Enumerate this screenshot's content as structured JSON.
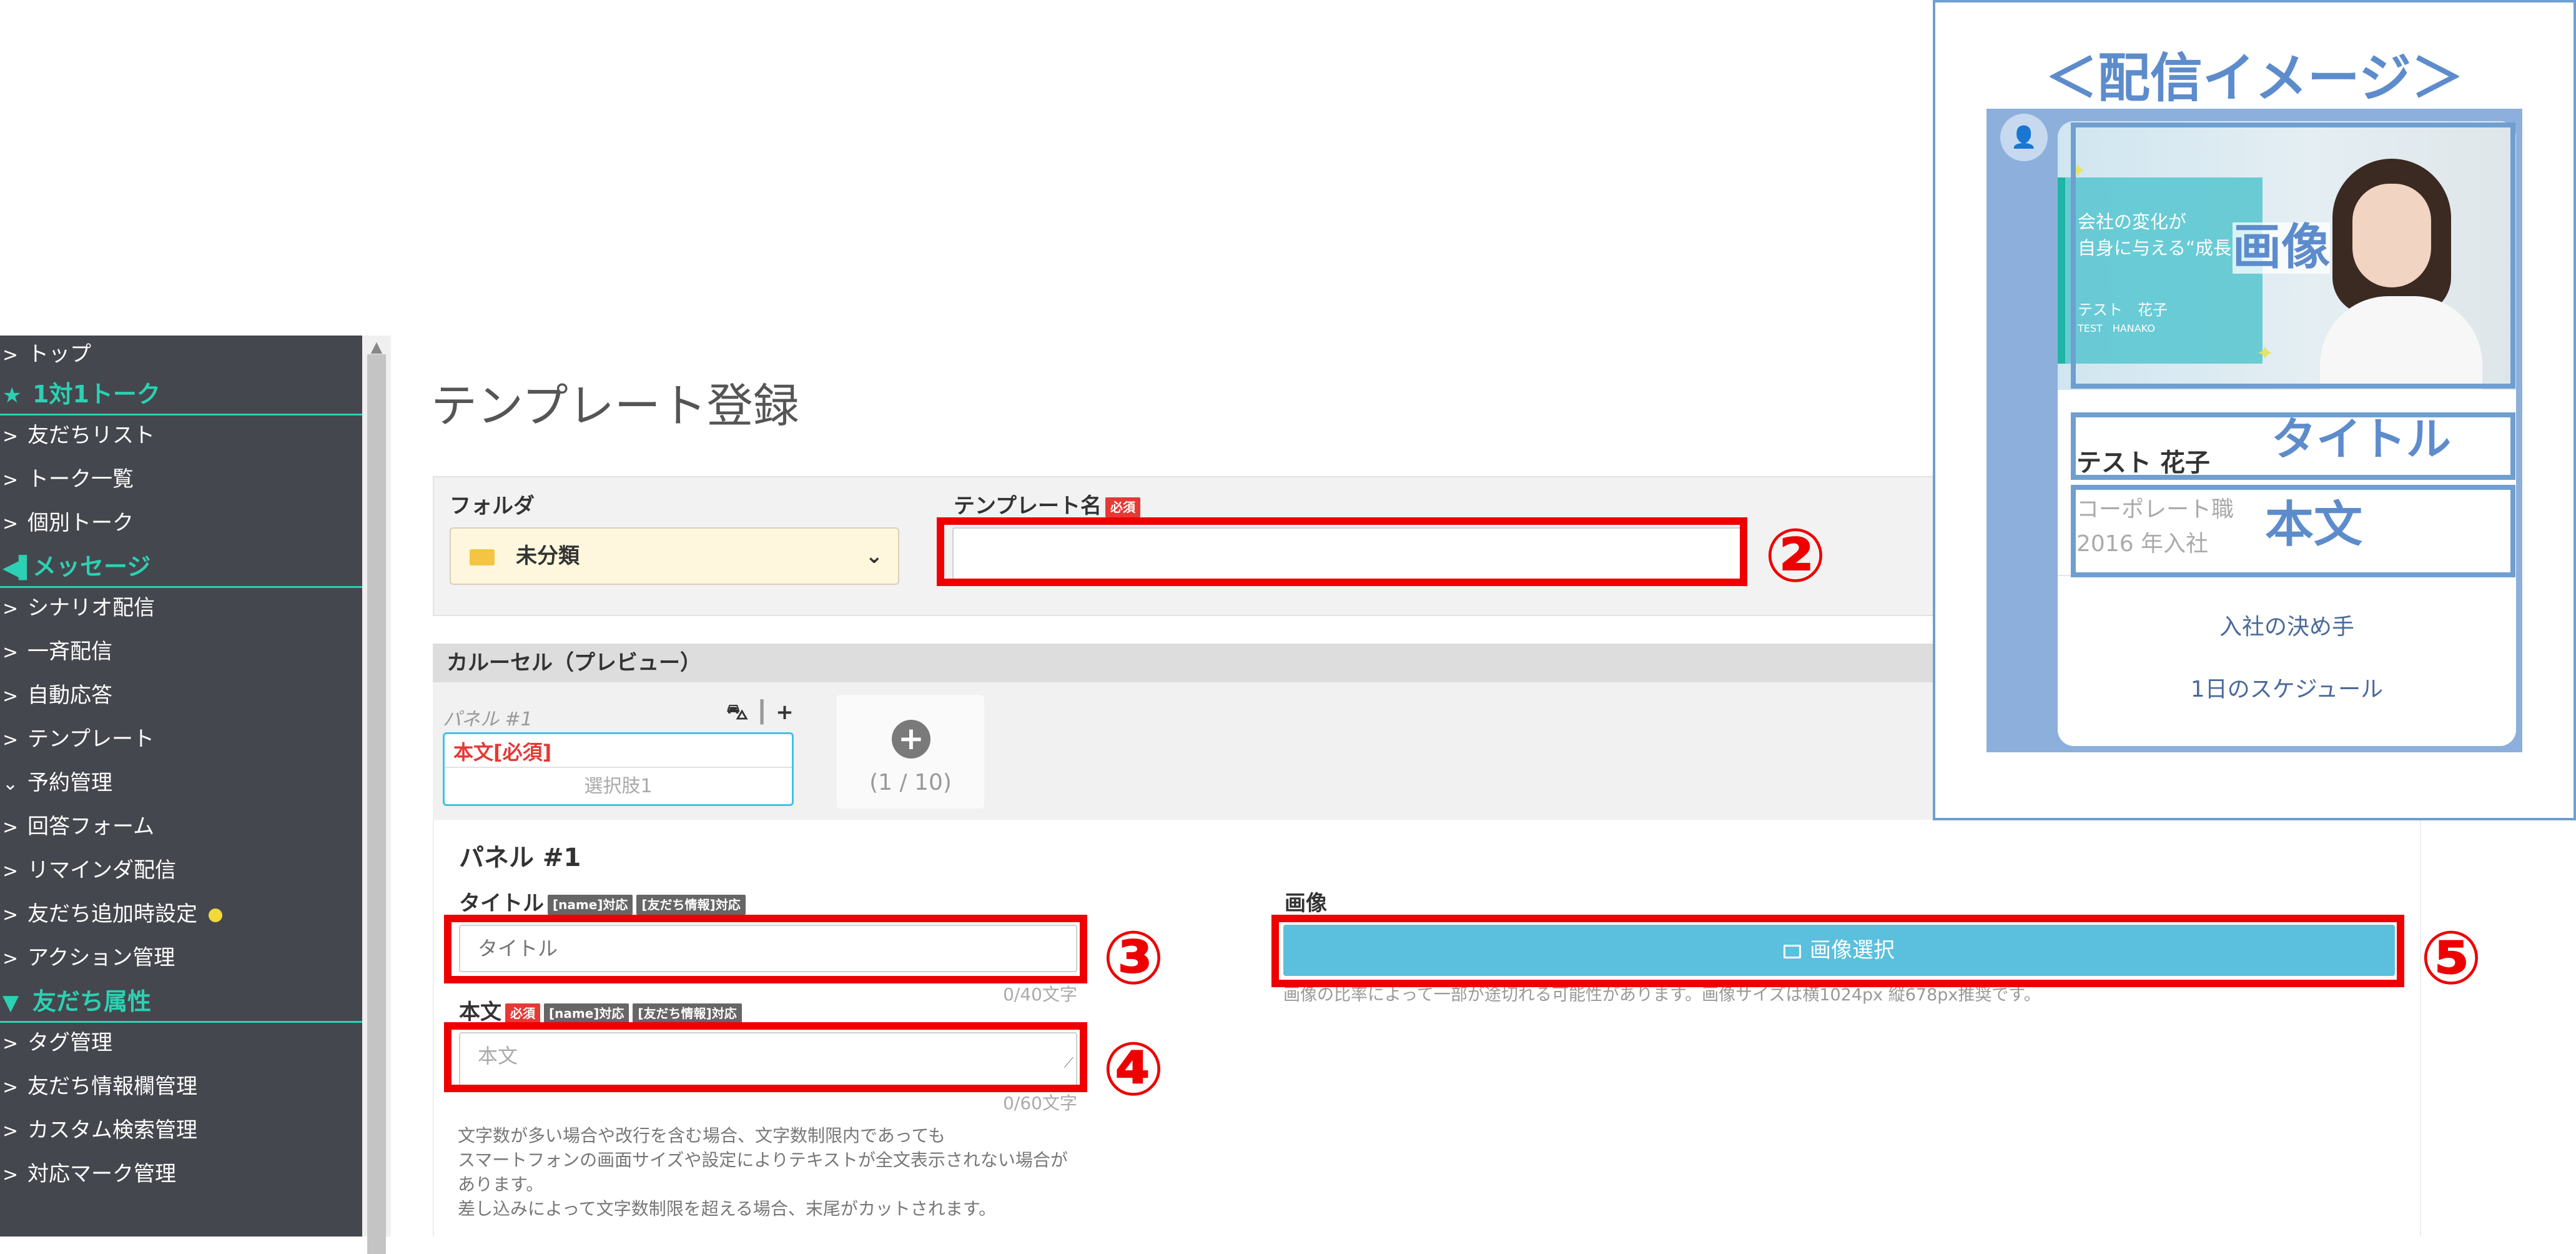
{
  "sidebar": {
    "items": [
      {
        "type": "item",
        "label": "トップ",
        "chevron": ">"
      },
      {
        "type": "header",
        "label": "1対1トーク",
        "icon": "★"
      },
      {
        "type": "item",
        "label": "友だちリスト",
        "chevron": ">"
      },
      {
        "type": "item",
        "label": "トーク一覧",
        "chevron": ">"
      },
      {
        "type": "item",
        "label": "個別トーク",
        "chevron": ">"
      },
      {
        "type": "header",
        "label": "メッセージ",
        "icon": "◀▌"
      },
      {
        "type": "item",
        "label": "シナリオ配信",
        "chevron": ">"
      },
      {
        "type": "item",
        "label": "一斉配信",
        "chevron": ">"
      },
      {
        "type": "item",
        "label": "自動応答",
        "chevron": ">"
      },
      {
        "type": "item",
        "label": "テンプレート",
        "chevron": ">"
      },
      {
        "type": "item",
        "label": "予約管理",
        "chevron": "⌄"
      },
      {
        "type": "item",
        "label": "回答フォーム",
        "chevron": ">"
      },
      {
        "type": "item",
        "label": "リマインダ配信",
        "chevron": ">"
      },
      {
        "type": "item",
        "label": "友だち追加時設定",
        "chevron": ">",
        "dot": true
      },
      {
        "type": "item",
        "label": "アクション管理",
        "chevron": ">"
      },
      {
        "type": "header",
        "label": "友だち属性",
        "icon": "▼"
      },
      {
        "type": "item",
        "label": "タグ管理",
        "chevron": ">"
      },
      {
        "type": "item",
        "label": "友だち情報欄管理",
        "chevron": ">"
      },
      {
        "type": "item",
        "label": "カスタム検索管理",
        "chevron": ">"
      },
      {
        "type": "item",
        "label": "対応マーク管理",
        "chevron": ">"
      }
    ]
  },
  "page": {
    "title": "テンプレート登録"
  },
  "form": {
    "folder_label": "フォルダ",
    "folder_value": "未分類",
    "template_name_label": "テンプレート名",
    "required_badge": "必須",
    "template_name_value": ""
  },
  "carousel": {
    "header": "カルーセル（プレビュー）",
    "panel_label": "パネル #1",
    "panel_tools": "⛍ ┃ +",
    "panel_body_label": "本文[必須]",
    "panel_choice": "選択肢1",
    "add_icon": "+",
    "count": "(1 / 10)"
  },
  "panel": {
    "title": "パネル #1",
    "title_label": "タイトル",
    "name_badge": "[name]対応",
    "info_badge": "[友だち情報]対応",
    "title_placeholder": "タイトル",
    "title_counter": "0/40文字",
    "body_label": "本文",
    "body_placeholder": "本文",
    "body_counter": "0/60文字",
    "image_label": "画像",
    "image_button": "画像選択",
    "image_note": "画像の比率によって一部が途切れる可能性があります。画像サイズは横1024px 縦678px推奨です。",
    "body_note_lines": [
      "文字数が多い場合や改行を含む場合、文字数制限内であっても",
      "スマートフォンの画面サイズや設定によりテキストが全文表示されない場合が",
      "あります。",
      "差し込みによって文字数制限を超える場合、末尾がカットされます。"
    ]
  },
  "annotations": {
    "n2": "②",
    "n3": "③",
    "n4": "④",
    "n5": "⑤",
    "color": "#ee0000"
  },
  "preview": {
    "title": "＜配信イメージ＞",
    "avatar_icon": "👤",
    "hero_text_lines": [
      "会社の変化が",
      "自身に与える“成長"
    ],
    "hero_name": "テスト　花子",
    "hero_sub": "TEST　HANAKO",
    "image_label": "画像",
    "card_title": "テスト 花子",
    "title_label": "タイトル",
    "card_text_lines": [
      "コーポレート職",
      "2016 年入社"
    ],
    "body_label": "本文",
    "actions": [
      "入社の決め手",
      "1日のスケジュール"
    ],
    "accent_color": "#5d8ccc"
  }
}
